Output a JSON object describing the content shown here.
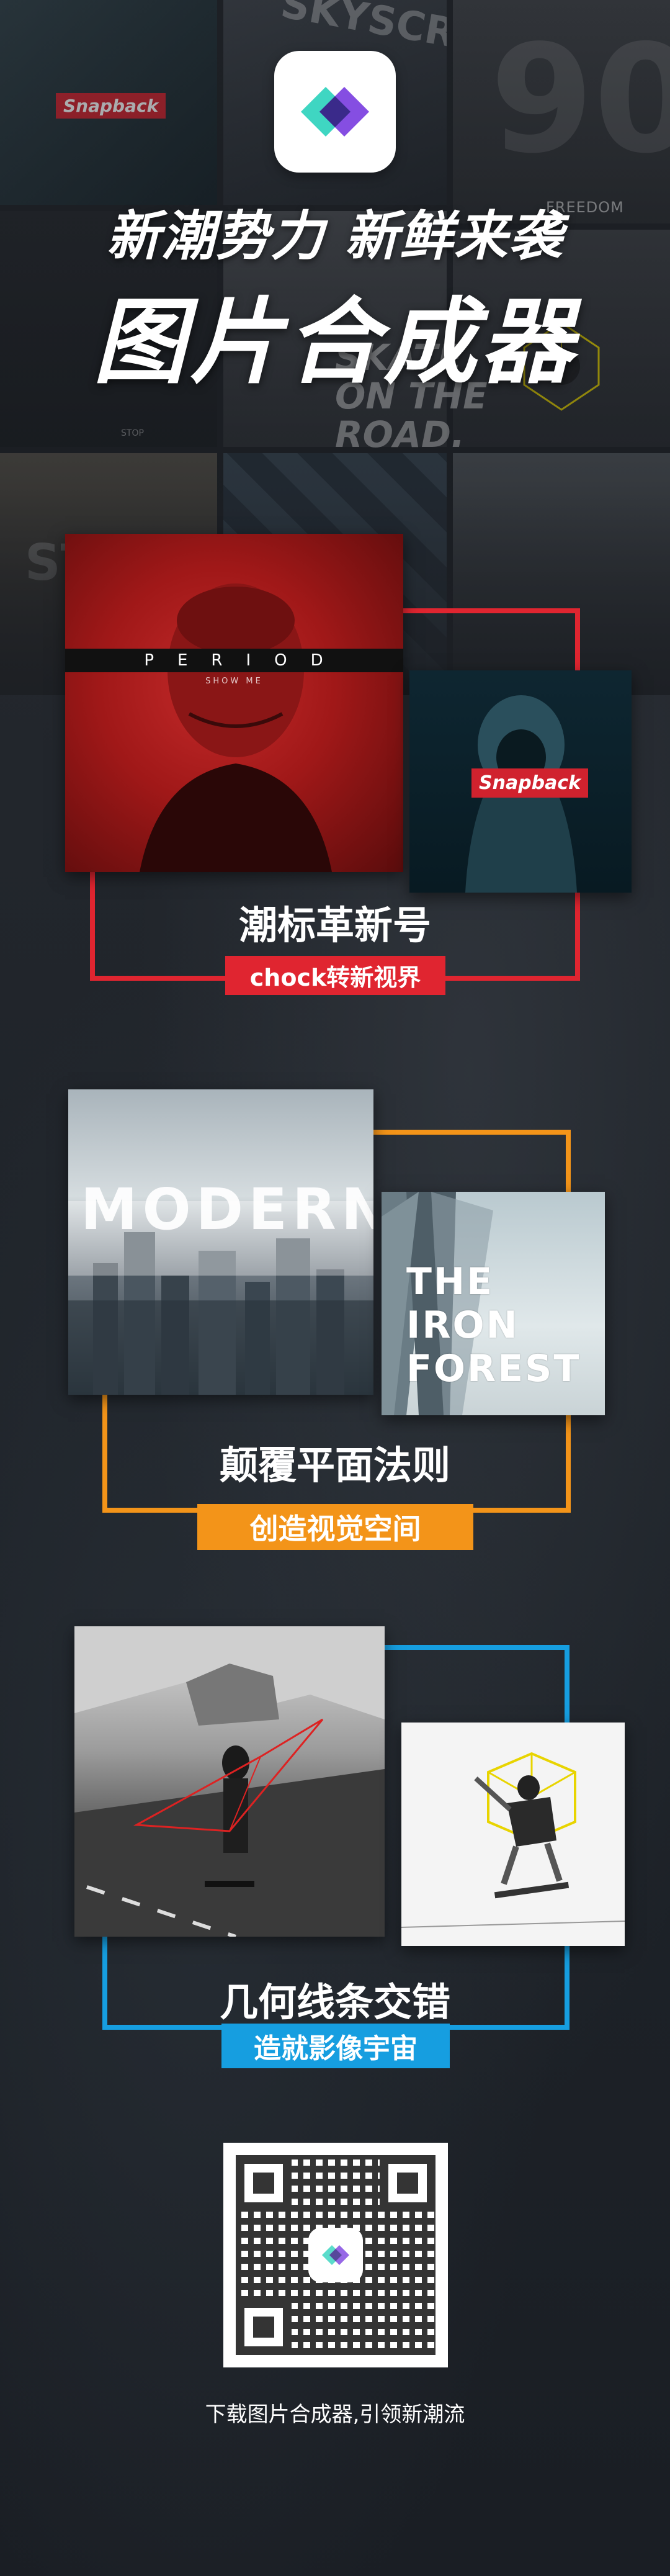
{
  "header": {
    "line1": "新潮势力 新鲜来袭",
    "line2": "图片合成器",
    "bg_snapback": "Snapback",
    "bg_skate": "SKATE\nON THE\nROAD.",
    "bg_freedom": "FREEDOM",
    "bg_stop": "STOP",
    "bg_st": "ST",
    "bg_90": "90"
  },
  "sections": [
    {
      "title": "潮标革新号",
      "tag": "chock转新视界",
      "accent": "#e02530",
      "main_overlay": "PERIOD",
      "main_sub": "SHOW ME",
      "side_overlay": "Snapback"
    },
    {
      "title": "颠覆平面法则",
      "tag": "创造视觉空间",
      "accent": "#f39419",
      "main_overlay": "MODERN",
      "side_overlay": "THE\nIRON\nFOREST"
    },
    {
      "title": "几何线条交错",
      "tag": "造就影像宇宙",
      "accent": "#169ee0"
    }
  ],
  "footer": {
    "text": "下载图片合成器,引领新潮流"
  },
  "icons": {
    "app_logo": "app-logo-icon",
    "qr": "qr-code-icon"
  }
}
